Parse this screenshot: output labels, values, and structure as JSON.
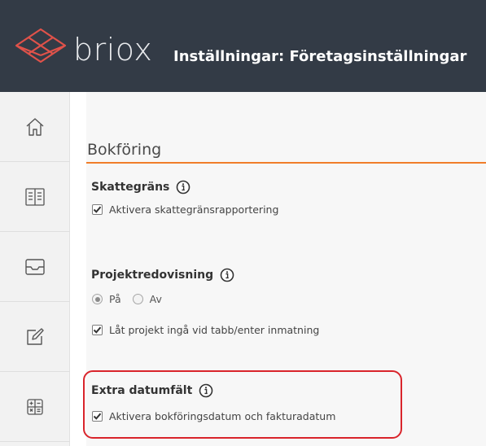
{
  "header": {
    "brand": "briox",
    "title": "Inställningar: Företagsinställningar",
    "colors": {
      "background": "#333b46",
      "logo_accent": "#e0524a"
    }
  },
  "sidebar": {
    "items": [
      {
        "icon": "home-icon"
      },
      {
        "icon": "ledger-book-icon"
      },
      {
        "icon": "inbox-tray-icon"
      },
      {
        "icon": "edit-note-icon"
      },
      {
        "icon": "calculator-icon"
      }
    ]
  },
  "section": {
    "title": "Bokföring",
    "accent_color": "#f07d2a"
  },
  "groups": {
    "skattegrans": {
      "title": "Skattegräns",
      "checkbox_label": "Aktivera skattegränsrapportering",
      "checked": true
    },
    "projekt": {
      "title": "Projektredovisning",
      "radio_on": "På",
      "radio_off": "Av",
      "selected": "På",
      "checkbox_label": "Låt projekt ingå vid tabb/enter inmatning",
      "checked": true
    },
    "extra": {
      "title": "Extra datumfält",
      "checkbox_label": "Aktivera bokföringsdatum och fakturadatum",
      "checked": true,
      "highlight_color": "#d9242b"
    }
  }
}
